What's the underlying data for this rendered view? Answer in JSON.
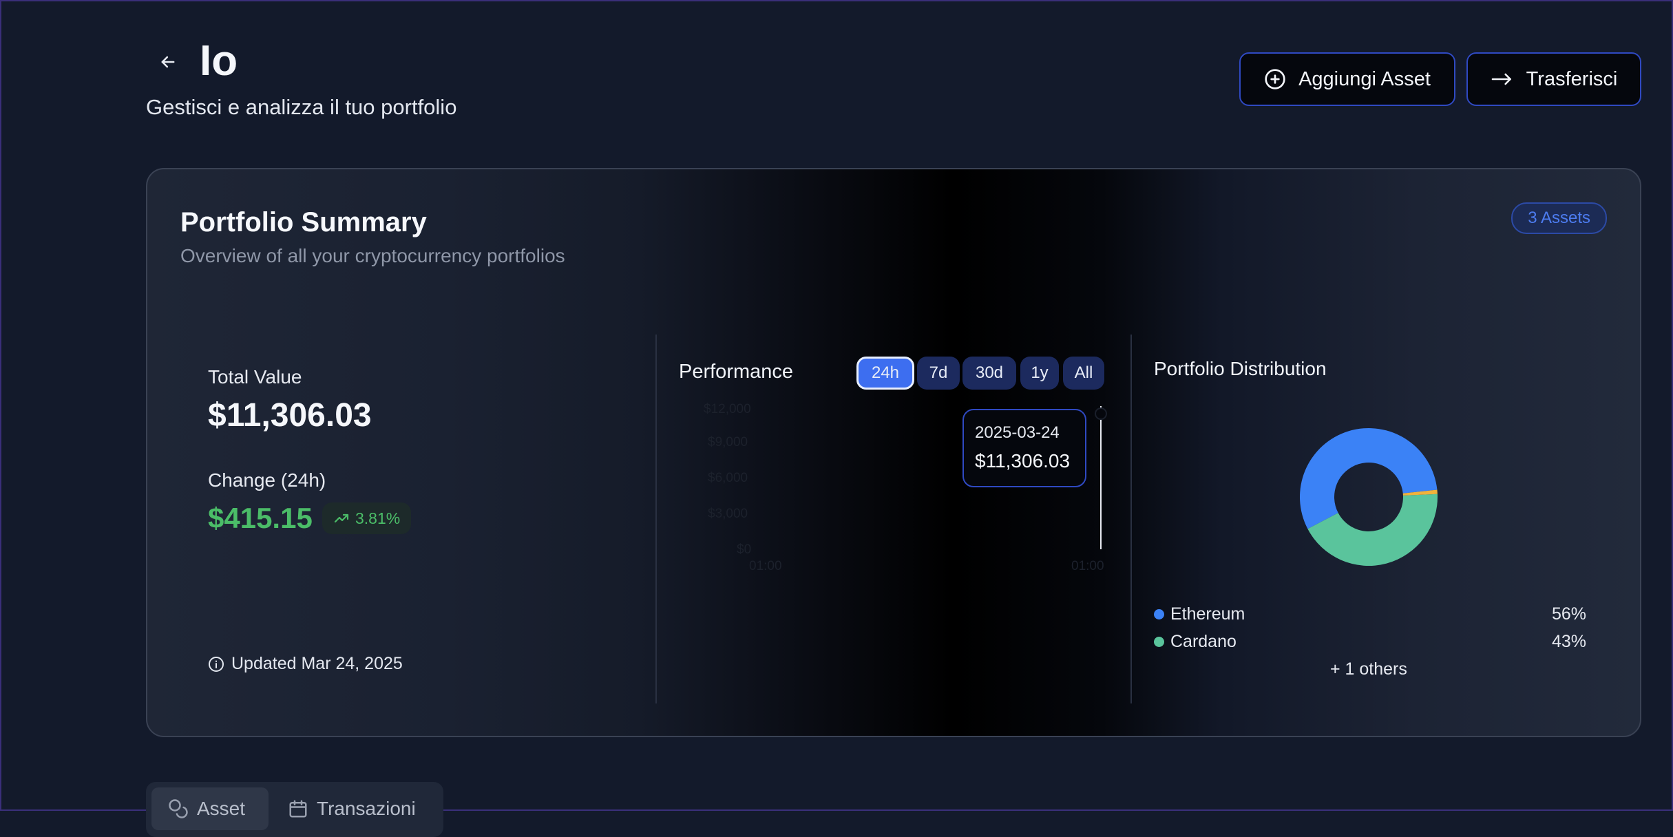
{
  "header": {
    "title": "Io",
    "subtitle": "Gestisci e analizza il tuo portfolio",
    "add_asset_label": "Aggiungi Asset",
    "transfer_label": "Trasferisci"
  },
  "summary": {
    "title": "Portfolio Summary",
    "subtitle": "Overview of all your cryptocurrency portfolios",
    "assets_badge": "3 Assets",
    "total_value_label": "Total Value",
    "total_value": "$11,306.03",
    "change_label": "Change (24h)",
    "change_value": "$415.15",
    "change_pct": "3.81%",
    "updated": "Updated Mar 24, 2025"
  },
  "performance": {
    "title": "Performance",
    "ranges": [
      "24h",
      "7d",
      "30d",
      "1y",
      "All"
    ],
    "active_range": "24h",
    "tooltip_date": "2025-03-24",
    "tooltip_value": "$11,306.03"
  },
  "chart_data": {
    "type": "line",
    "title": "Performance",
    "x_ticks": [
      "01:00",
      "01:00"
    ],
    "y_ticks": [
      "$12,000",
      "$9,000",
      "$6,000",
      "$3,000",
      "$0"
    ],
    "ylim": [
      0,
      12000
    ],
    "x": [
      "2025-03-24"
    ],
    "values": [
      11306.03
    ]
  },
  "distribution": {
    "title": "Portfolio Distribution",
    "others": "+ 1 others",
    "legend": [
      {
        "name": "Ethereum",
        "pct": "56%",
        "color": "#3b82f6"
      },
      {
        "name": "Cardano",
        "pct": "43%",
        "color": "#5ac49c"
      }
    ],
    "slices": [
      {
        "name": "Ethereum",
        "value": 56,
        "color": "#3b82f6"
      },
      {
        "name": "Cardano",
        "value": 43,
        "color": "#5ac49c"
      },
      {
        "name": "Other",
        "value": 1,
        "color": "#f0b23c"
      }
    ]
  },
  "tabs": [
    {
      "label": "Asset"
    },
    {
      "label": "Transazioni"
    }
  ],
  "colors": {
    "accent": "#3d6ef0",
    "positive": "#4bbd68",
    "button_border": "#2f49c2"
  }
}
